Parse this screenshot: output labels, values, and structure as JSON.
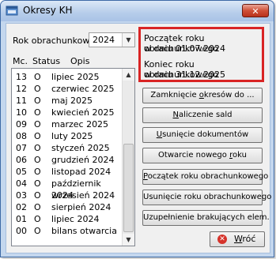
{
  "window": {
    "title": "Okresy KH",
    "close_glyph": "✕"
  },
  "year": {
    "label": "Rok obrachunkowy",
    "value": "2024"
  },
  "list": {
    "headers": {
      "mc": "Mc.",
      "status": "Status",
      "opis": "Opis"
    },
    "rows": [
      {
        "mc": "13",
        "status": "O",
        "opis": "lipiec 2025"
      },
      {
        "mc": "12",
        "status": "O",
        "opis": "czerwiec 2025"
      },
      {
        "mc": "11",
        "status": "O",
        "opis": "maj 2025"
      },
      {
        "mc": "10",
        "status": "O",
        "opis": "kwiecień 2025"
      },
      {
        "mc": "09",
        "status": "O",
        "opis": "marzec 2025"
      },
      {
        "mc": "08",
        "status": "O",
        "opis": "luty 2025"
      },
      {
        "mc": "07",
        "status": "O",
        "opis": "styczeń 2025"
      },
      {
        "mc": "06",
        "status": "O",
        "opis": "grudzień 2024"
      },
      {
        "mc": "05",
        "status": "O",
        "opis": "listopad 2024"
      },
      {
        "mc": "04",
        "status": "O",
        "opis": "październik 2024"
      },
      {
        "mc": "03",
        "status": "O",
        "opis": "wrzesień 2024"
      },
      {
        "mc": "02",
        "status": "O",
        "opis": "sierpień 2024"
      },
      {
        "mc": "01",
        "status": "O",
        "opis": "lipiec 2024"
      },
      {
        "mc": "00",
        "status": "O",
        "opis": "bilans otwarcia"
      }
    ]
  },
  "info": {
    "start_line1": "Początek roku obrachunkowego",
    "start_line2": "w dniu 01.07.2024",
    "end_line1": "Koniec roku obrachunkowego",
    "end_line2": "w dniu 31.12.2025"
  },
  "buttons": [
    {
      "name": "close-periods-button",
      "pre": "Zamknięcie ",
      "key": "o",
      "post": "kresów do ..."
    },
    {
      "name": "calculate-balances-button",
      "pre": "",
      "key": "N",
      "post": "aliczenie sald"
    },
    {
      "name": "delete-documents-button",
      "pre": "",
      "key": "U",
      "post": "sunięcie dokumentów"
    },
    {
      "name": "open-new-year-button",
      "pre": "Otwarcie nowego ",
      "key": "r",
      "post": "oku"
    },
    {
      "name": "start-fiscal-year-button",
      "pre": "",
      "key": "P",
      "post": "oczątek roku obrachunkowego"
    },
    {
      "name": "delete-fiscal-year-button",
      "pre": "Usunięcie roku obrachunkowego",
      "key": "",
      "post": ""
    },
    {
      "name": "fill-missing-elements-button",
      "pre": "Uzupełnienie brakujących elem.",
      "key": "",
      "post": ""
    }
  ],
  "return_button": {
    "pre": "",
    "key": "W",
    "post": "róć",
    "icon": "cancel-icon"
  },
  "colors": {
    "highlight_border": "#d92424",
    "close_button": "#cf4f37"
  }
}
